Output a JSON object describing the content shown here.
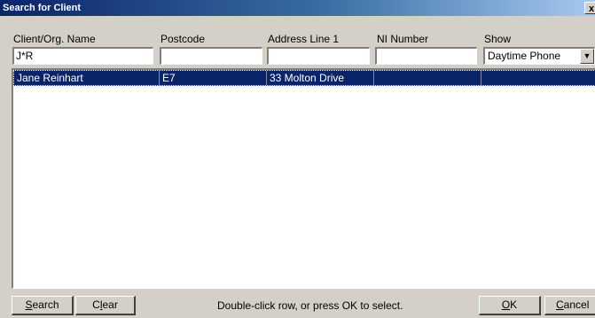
{
  "window": {
    "title": "Search for Client",
    "close_glyph": "x"
  },
  "search_fields": {
    "client_name": {
      "label": "Client/Org. Name",
      "value": "J*R"
    },
    "postcode": {
      "label": "Postcode",
      "value": ""
    },
    "address_line_1": {
      "label": "Address Line 1",
      "value": ""
    },
    "ni_number": {
      "label": "NI Number",
      "value": ""
    },
    "show": {
      "label": "Show",
      "selected": "Daytime Phone"
    }
  },
  "results": [
    {
      "name": "Jane Reinhart",
      "postcode": "E7",
      "address": "33 Molton Drive",
      "ni": "",
      "show": "",
      "selected": true
    }
  ],
  "buttons": {
    "search": {
      "pre": "",
      "key": "S",
      "post": "earch"
    },
    "clear": {
      "pre": "C",
      "key": "l",
      "post": "ear"
    },
    "ok": {
      "pre": "",
      "key": "O",
      "post": "K"
    },
    "cancel": {
      "pre": "",
      "key": "C",
      "post": "ancel"
    }
  },
  "hint": "Double-click row, or press OK to select.",
  "colors": {
    "title_bar": "#0a246a",
    "selection": "#0a246a",
    "dialog": "#d4d0c8"
  }
}
